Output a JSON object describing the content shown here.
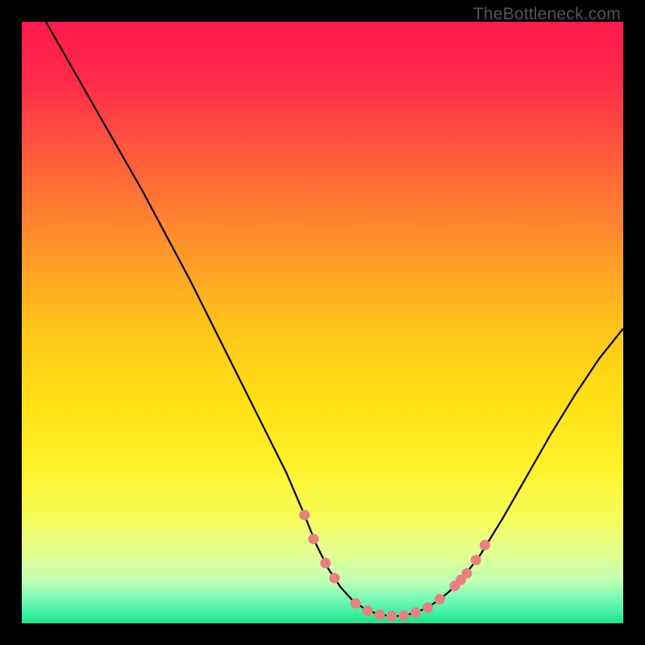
{
  "watermark": "TheBottleneck.com",
  "chart_data": {
    "type": "line",
    "title": "",
    "xlabel": "",
    "ylabel": "",
    "x_range": [
      0,
      100
    ],
    "y_range": [
      0,
      100
    ],
    "gradient_stops": [
      {
        "offset": 0.0,
        "color": "#ff1a4d"
      },
      {
        "offset": 0.1,
        "color": "#ff2b4a"
      },
      {
        "offset": 0.22,
        "color": "#ff5a3d"
      },
      {
        "offset": 0.35,
        "color": "#ff8a2e"
      },
      {
        "offset": 0.5,
        "color": "#ffc21a"
      },
      {
        "offset": 0.63,
        "color": "#ffe015"
      },
      {
        "offset": 0.74,
        "color": "#fff22a"
      },
      {
        "offset": 0.82,
        "color": "#f7fb55"
      },
      {
        "offset": 0.88,
        "color": "#e6ff90"
      },
      {
        "offset": 0.93,
        "color": "#c0ffb4"
      },
      {
        "offset": 0.965,
        "color": "#68f7b4"
      },
      {
        "offset": 1.0,
        "color": "#18e88b"
      }
    ],
    "curve": [
      {
        "x": 4.0,
        "y": 100.0
      },
      {
        "x": 8.0,
        "y": 93.0
      },
      {
        "x": 12.0,
        "y": 86.0
      },
      {
        "x": 16.0,
        "y": 79.0
      },
      {
        "x": 20.0,
        "y": 72.0
      },
      {
        "x": 24.0,
        "y": 64.5
      },
      {
        "x": 28.0,
        "y": 57.0
      },
      {
        "x": 32.0,
        "y": 49.0
      },
      {
        "x": 36.0,
        "y": 41.0
      },
      {
        "x": 40.0,
        "y": 33.0
      },
      {
        "x": 44.0,
        "y": 25.0
      },
      {
        "x": 47.0,
        "y": 18.0
      },
      {
        "x": 49.0,
        "y": 13.0
      },
      {
        "x": 51.0,
        "y": 9.0
      },
      {
        "x": 53.0,
        "y": 6.0
      },
      {
        "x": 55.0,
        "y": 3.8
      },
      {
        "x": 57.0,
        "y": 2.4
      },
      {
        "x": 59.0,
        "y": 1.6
      },
      {
        "x": 61.0,
        "y": 1.2
      },
      {
        "x": 63.0,
        "y": 1.2
      },
      {
        "x": 65.0,
        "y": 1.6
      },
      {
        "x": 67.0,
        "y": 2.4
      },
      {
        "x": 69.0,
        "y": 3.6
      },
      {
        "x": 71.0,
        "y": 5.2
      },
      {
        "x": 73.0,
        "y": 7.2
      },
      {
        "x": 76.0,
        "y": 11.0
      },
      {
        "x": 80.0,
        "y": 17.5
      },
      {
        "x": 84.0,
        "y": 24.5
      },
      {
        "x": 88.0,
        "y": 31.5
      },
      {
        "x": 92.0,
        "y": 38.0
      },
      {
        "x": 96.0,
        "y": 44.0
      },
      {
        "x": 100.0,
        "y": 49.0
      }
    ],
    "marker_points": [
      {
        "x": 47.0,
        "y": 18.0
      },
      {
        "x": 48.5,
        "y": 14.0
      },
      {
        "x": 50.5,
        "y": 10.0
      },
      {
        "x": 52.0,
        "y": 7.5
      },
      {
        "x": 55.5,
        "y": 3.3
      },
      {
        "x": 57.5,
        "y": 2.1
      },
      {
        "x": 59.5,
        "y": 1.4
      },
      {
        "x": 61.5,
        "y": 1.2
      },
      {
        "x": 63.5,
        "y": 1.3
      },
      {
        "x": 65.5,
        "y": 1.8
      },
      {
        "x": 67.5,
        "y": 2.6
      },
      {
        "x": 69.5,
        "y": 4.0
      },
      {
        "x": 72.0,
        "y": 6.2
      },
      {
        "x": 73.0,
        "y": 7.2
      },
      {
        "x": 74.0,
        "y": 8.3
      },
      {
        "x": 75.5,
        "y": 10.5
      },
      {
        "x": 77.0,
        "y": 13.0
      }
    ],
    "marker_color": "#e88080",
    "curve_color": "#000000"
  }
}
